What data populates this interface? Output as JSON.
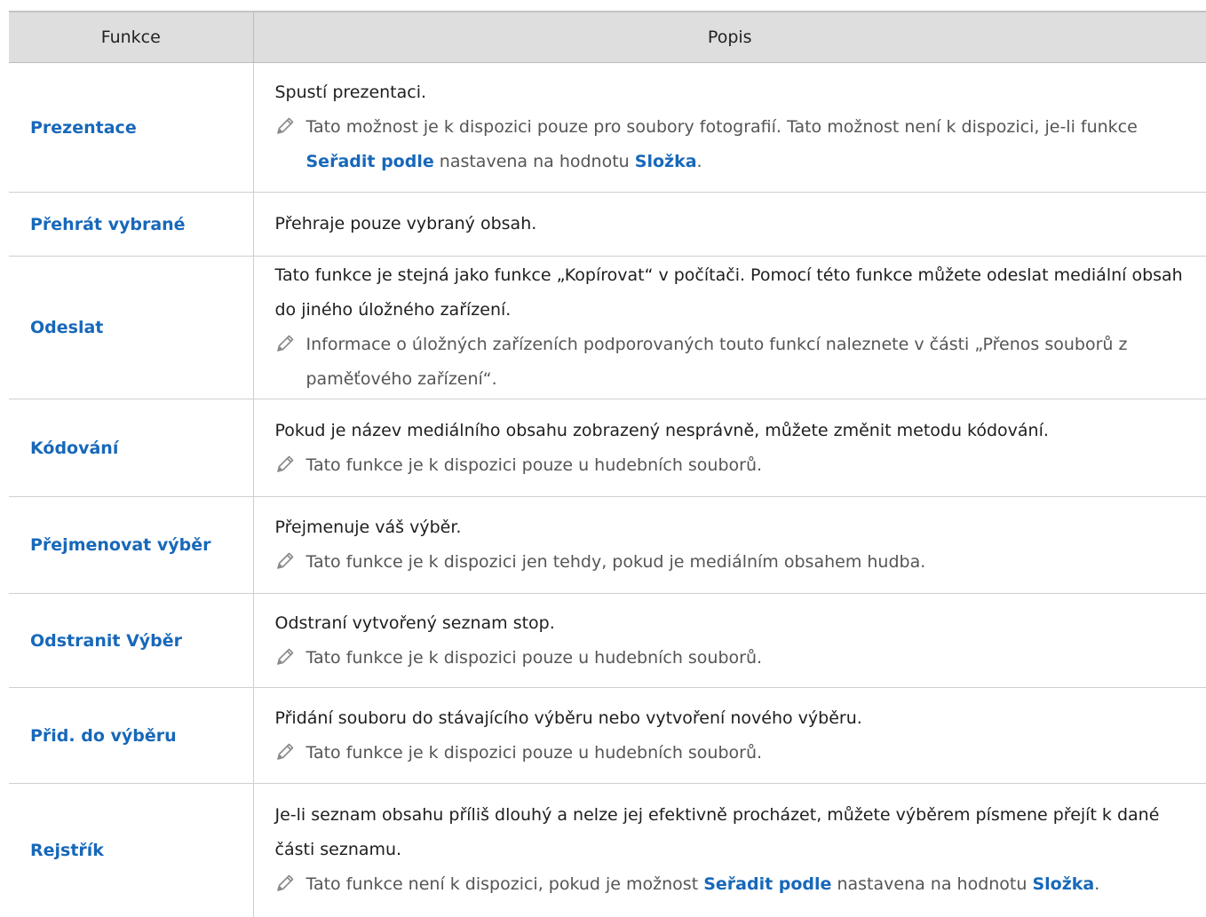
{
  "table": {
    "headers": {
      "function": "Funkce",
      "description": "Popis"
    },
    "rows": [
      {
        "name": "Prezentace",
        "desc": [
          "Spustí prezentaci."
        ],
        "note": [
          {
            "t": "Tato možnost je k dispozici pouze pro soubory fotografií. Tato možnost není k dispozici, je-li funkce "
          },
          {
            "t": "Seřadit podle",
            "hl": true
          },
          {
            "t": " nastavena na hodnotu "
          },
          {
            "t": "Složka",
            "hl": true
          },
          {
            "t": "."
          }
        ]
      },
      {
        "name": "Přehrát vybrané",
        "desc": [
          "Přehraje pouze vybraný obsah."
        ],
        "note": null
      },
      {
        "name": "Odeslat",
        "desc": [
          "Tato funkce je stejná jako funkce „Kopírovat“ v počítači. Pomocí této funkce můžete odeslat mediální obsah do jiného úložného zařízení."
        ],
        "note": [
          {
            "t": "Informace o úložných zařízeních podporovaných touto funkcí naleznete v části „Přenos souborů z paměťového zařízení“."
          }
        ]
      },
      {
        "name": "Kódování",
        "desc": [
          "Pokud je název mediálního obsahu zobrazený nesprávně, můžete změnit metodu kódování."
        ],
        "note": [
          {
            "t": "Tato funkce je k dispozici pouze u hudebních souborů."
          }
        ]
      },
      {
        "name": "Přejmenovat výběr",
        "desc": [
          "Přejmenuje váš výběr."
        ],
        "note": [
          {
            "t": "Tato funkce je k dispozici jen tehdy, pokud je mediálním obsahem hudba."
          }
        ]
      },
      {
        "name": "Odstranit Výběr",
        "desc": [
          "Odstraní vytvořený seznam stop."
        ],
        "note": [
          {
            "t": "Tato funkce je k dispozici pouze u hudebních souborů."
          }
        ]
      },
      {
        "name": "Přid. do výběru",
        "desc": [
          "Přidání souboru do stávajícího výběru nebo vytvoření nového výběru."
        ],
        "note": [
          {
            "t": "Tato funkce je k dispozici pouze u hudebních souborů."
          }
        ]
      },
      {
        "name": "Rejstřík",
        "desc": [
          "Je-li seznam obsahu příliš dlouhý a nelze jej efektivně procházet, můžete výběrem písmene přejít k dané části seznamu."
        ],
        "note": [
          {
            "t": "Tato funkce není k dispozici, pokud je možnost "
          },
          {
            "t": "Seřadit podle",
            "hl": true
          },
          {
            "t": " nastavena na hodnotu "
          },
          {
            "t": "Složka",
            "hl": true
          },
          {
            "t": "."
          }
        ]
      }
    ]
  },
  "icons": {
    "note": "pencil-icon"
  },
  "colors": {
    "link": "#1768b9",
    "header_bg": "#dedede",
    "note_text": "#555555"
  }
}
